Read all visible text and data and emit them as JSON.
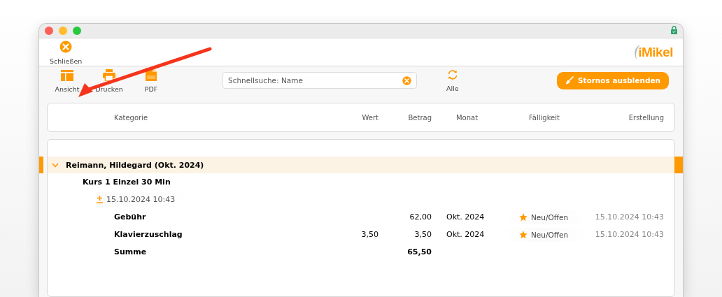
{
  "window": {
    "locked": true
  },
  "top_toolbar": {
    "buttons": [
      {
        "kind": "close",
        "label": "Schließen"
      }
    ],
    "logo": "iMikel"
  },
  "toolbar": {
    "buttons": [
      {
        "kind": "layout",
        "label": "Ansicht"
      },
      {
        "kind": "print",
        "label": "Drucken"
      },
      {
        "kind": "pdf",
        "label": "PDF"
      }
    ],
    "search": {
      "placeholder": "Schnellsuche: Name"
    },
    "refresh": {
      "label": "Alle"
    },
    "action_button": {
      "label": "Stornos ausblenden"
    }
  },
  "table": {
    "columns": [
      {
        "label": "Kategorie"
      },
      {
        "label": "Wert"
      },
      {
        "label": "Betrag"
      },
      {
        "label": "Monat"
      },
      {
        "label": "Fälligkeit"
      },
      {
        "label": "Erstellung"
      }
    ],
    "groups": [
      {
        "label": "Reimann, Hildegard (Okt. 2024)",
        "expanded": true,
        "selected": true,
        "children": [
          {
            "label": "Kurs 1 Einzel 30 Min",
            "children": [
              {
                "label": "15.10.2024 10:43",
                "children": [
                  {
                    "kind": "line",
                    "category": "Gebühr",
                    "betrag": "62,00",
                    "monat": "Okt. 2024",
                    "status": "Neu/Offen",
                    "created": "15.10.2024 10:43"
                  },
                  {
                    "kind": "line",
                    "category": "Klavierzuschlag",
                    "wert": "3,50",
                    "betrag": "3,50",
                    "monat": "Okt. 2024",
                    "status": "Neu/Offen",
                    "created": "15.10.2024 10:43"
                  },
                  {
                    "kind": "total",
                    "category": "Summe",
                    "betrag": "65,50"
                  }
                ]
              }
            ]
          }
        ]
      }
    ]
  },
  "annotation": {
    "arrow": true
  }
}
